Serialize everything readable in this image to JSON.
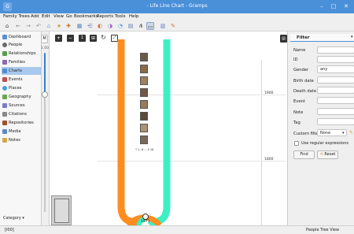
{
  "titlebar": {
    "title": "- Life Line Chart - Gramps",
    "app_icon_label": "G"
  },
  "menu": [
    "Family Trees",
    "Add",
    "Edit",
    "View",
    "Go",
    "Bookmarks",
    "Reports",
    "Tools",
    "Help"
  ],
  "sidebar": {
    "items": [
      {
        "label": "Dashboard",
        "color": "#5b8fd0"
      },
      {
        "label": "People",
        "color": "#6a6a6a"
      },
      {
        "label": "Relationships",
        "color": "#5a9b4f"
      },
      {
        "label": "Families",
        "color": "#8a6ab0"
      },
      {
        "label": "Charts",
        "color": "#4a8fd8",
        "selected": true
      },
      {
        "label": "Events",
        "color": "#c0504d"
      },
      {
        "label": "Places",
        "color": "#4aa0d8"
      },
      {
        "label": "Geography",
        "color": "#6aa84f"
      },
      {
        "label": "Sources",
        "color": "#7a7acc"
      },
      {
        "label": "Citations",
        "color": "#888888"
      },
      {
        "label": "Repositories",
        "color": "#a0522d"
      },
      {
        "label": "Media",
        "color": "#5a8ac6"
      },
      {
        "label": "Notes",
        "color": "#d4a84a"
      }
    ],
    "category_label": "Category"
  },
  "zoom": {
    "mode_label": "M",
    "value": "1.00",
    "level": 0.5
  },
  "chart": {
    "year_labels": [
      "1900",
      "1800"
    ],
    "bottom_label": "1971",
    "person_label": "T 1, 8 ... 4 18"
  },
  "filter": {
    "title": "Filter",
    "fields": {
      "name": "Name",
      "id": "ID",
      "gender": "Gender",
      "gender_value": "any",
      "birth": "Birth date",
      "death": "Death date",
      "event": "Event",
      "note": "Note",
      "tag": "Tag",
      "custom": "Custom filter",
      "custom_value": "None"
    },
    "regex_label": "Use regular expressions",
    "find_label": "Find",
    "reset_label": "Reset"
  },
  "status": {
    "left": "[I00]",
    "right": "People Tree View"
  }
}
